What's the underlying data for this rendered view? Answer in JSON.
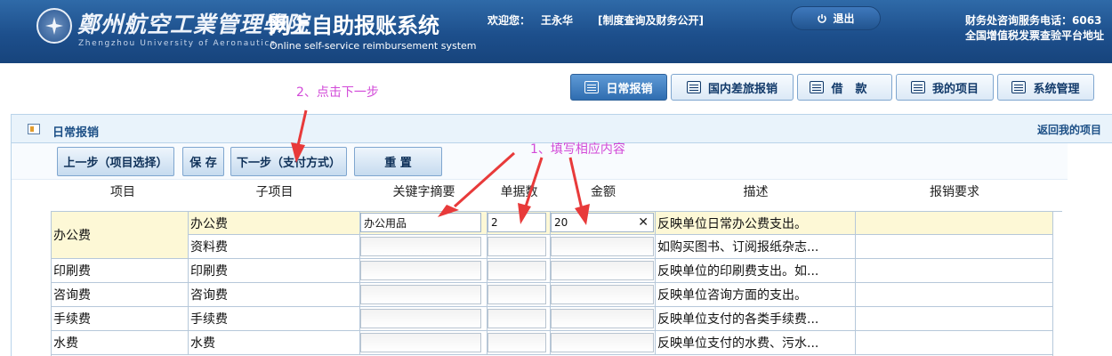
{
  "header": {
    "school_cn": "鄭州航空工業管理學院",
    "school_en": "Zhengzhou University of Aeronautics",
    "system_title": "网上自助报账系统",
    "system_subtitle": "Online self-service reimbursement system",
    "welcome_label": "欢迎您：",
    "user_name": "王永华",
    "policy_link": "[制度查询及财务公开]",
    "logout_label": "退出",
    "hotline": "财务处咨询服务电话：6063",
    "platform": "全国增值税发票查验平台地址"
  },
  "nav": {
    "tabs": [
      {
        "label": "日常报销",
        "active": true
      },
      {
        "label": "国内差旅报销",
        "active": false
      },
      {
        "label": "借款",
        "active": false
      },
      {
        "label": "我的项目",
        "active": false
      },
      {
        "label": "系统管理",
        "active": false
      }
    ]
  },
  "panel": {
    "title": "日常报销",
    "back_link": "返回我的项目"
  },
  "toolbar": {
    "prev_label": "上一步（项目选择）",
    "save_label": "保 存",
    "next_label": "下一步（支付方式）",
    "reset_label": "重 置"
  },
  "annotations": {
    "step_fill": "1、填写相应内容",
    "step_next": "2、点击下一步",
    "color": "#d24ad8"
  },
  "columns": [
    "项目",
    "子项目",
    "关键字摘要",
    "单据数",
    "金额",
    "描述",
    "报销要求"
  ],
  "rows": [
    {
      "category": "办公费",
      "item": "办公费",
      "keyword": "办公用品",
      "count": "2",
      "amount": "20",
      "desc": "反映单位日常办公费支出。",
      "req": ""
    },
    {
      "category": "",
      "item": "资料费",
      "keyword": "",
      "count": "",
      "amount": "",
      "desc": "如购买图书、订阅报纸杂志...",
      "req": ""
    },
    {
      "category": "印刷费",
      "item": "印刷费",
      "keyword": "",
      "count": "",
      "amount": "",
      "desc": "反映单位的印刷费支出。如...",
      "req": ""
    },
    {
      "category": "咨询费",
      "item": "咨询费",
      "keyword": "",
      "count": "",
      "amount": "",
      "desc": "反映单位咨询方面的支出。",
      "req": ""
    },
    {
      "category": "手续费",
      "item": "手续费",
      "keyword": "",
      "count": "",
      "amount": "",
      "desc": "反映单位支付的各类手续费...",
      "req": ""
    },
    {
      "category": "水费",
      "item": "水费",
      "keyword": "",
      "count": "",
      "amount": "",
      "desc": "反映单位支付的水费、污水...",
      "req": ""
    }
  ],
  "colors": {
    "header_blue": "#1d4f8c",
    "highlight_row": "#fdf8d6",
    "annotation": "#d24ad8",
    "arrow_red": "#e83a3a"
  }
}
